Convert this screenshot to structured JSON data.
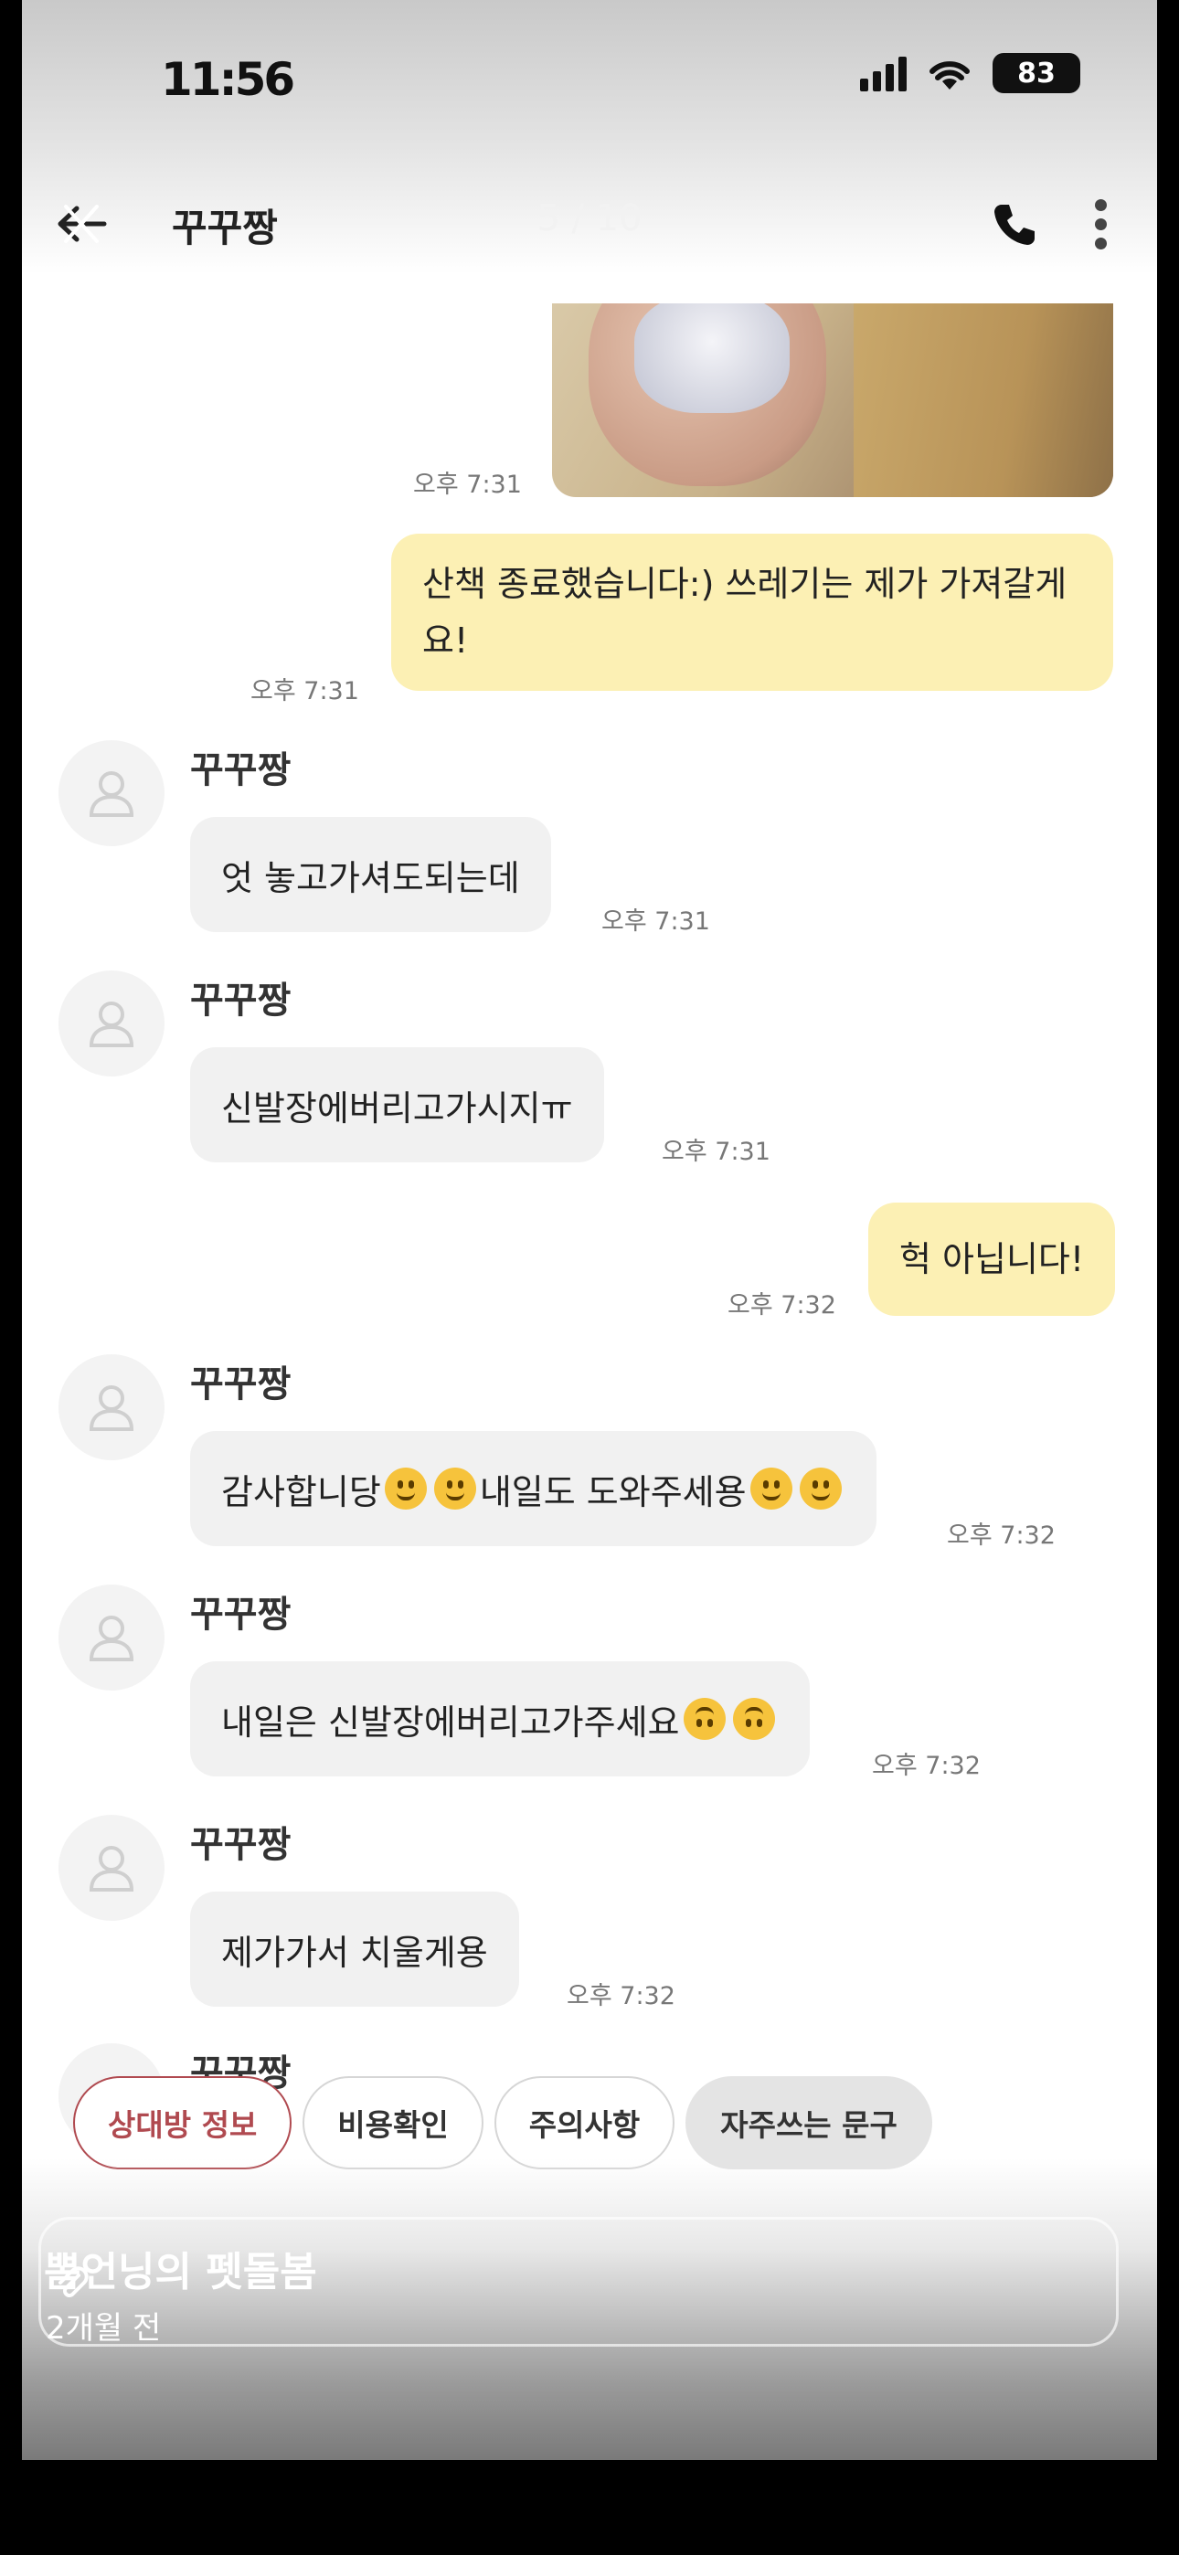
{
  "status": {
    "time": "11:56",
    "battery": "83"
  },
  "header": {
    "title": "꾸꾸짱",
    "page_counter": "5 / 10"
  },
  "messages": {
    "photo_time": "오후 7:31",
    "m1": {
      "text": "산책 종료했습니다:) 쓰레기는 제가 가져갈게요!",
      "time": "오후 7:31"
    },
    "m2": {
      "sender": "꾸꾸짱",
      "text": "엇 놓고가셔도되는데",
      "time": "오후 7:31"
    },
    "m3": {
      "sender": "꾸꾸짱",
      "text": "신발장에버리고가시지ㅠ",
      "time": "오후 7:31"
    },
    "m4": {
      "text": "헉 아닙니다!",
      "time": "오후 7:32"
    },
    "m5": {
      "sender": "꾸꾸짱",
      "text_a": "감사합니당",
      "text_b": "내일도 도와주세용",
      "time": "오후 7:32"
    },
    "m6": {
      "sender": "꾸꾸짱",
      "text": "내일은 신발장에버리고가주세요",
      "time": "오후 7:32"
    },
    "m7": {
      "sender": "꾸꾸짱",
      "text": "제가가서 치울게용",
      "time": "오후 7:32"
    },
    "m8": {
      "sender": "꾸꾸짱"
    }
  },
  "chips": [
    "상대방 정보",
    "비용확인",
    "주의사항",
    "자주쓰는 문구"
  ],
  "story": {
    "name": "뽐언닝의 펫돌봄",
    "time": "2개월 전"
  },
  "icons": {
    "back": "back-arrow-icon",
    "call": "phone-icon",
    "menu": "more-vertical-icon",
    "avatar": "person-icon",
    "emoji_smile": "slight-smile-emoji",
    "emoji_upside": "upside-down-emoji"
  },
  "colors": {
    "my_bubble": "#fcf0b4",
    "other_bubble": "#f1f1f1",
    "chip_active": "#b04a50"
  }
}
